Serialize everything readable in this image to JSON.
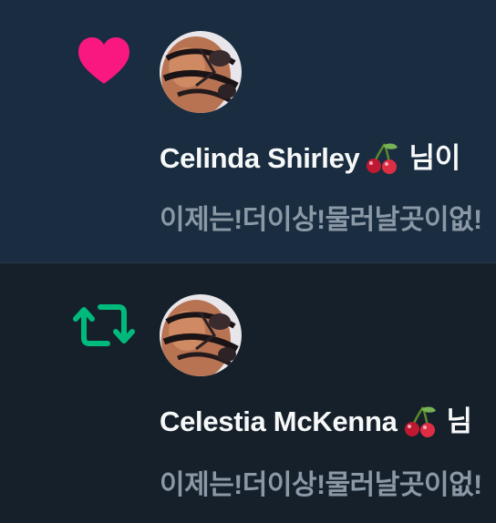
{
  "colors": {
    "unread_background": "#192c40",
    "read_background": "#15202b",
    "like": "#f91880",
    "retweet": "#00ba7c",
    "name_text": "#f7f9f9",
    "snippet_text": "#8b98a5"
  },
  "notifications": [
    {
      "type": "like",
      "icon": "heart-icon",
      "unread": true,
      "user_name": "Celinda Shirley",
      "name_emoji": "cherries-emoji",
      "action_suffix": "님이",
      "snippet": "이제는!더이상!물러날곳이없!"
    },
    {
      "type": "retweet",
      "icon": "retweet-icon",
      "unread": false,
      "user_name": "Celestia McKenna",
      "name_emoji": "cherries-emoji",
      "action_suffix": "님",
      "snippet": "이제는!더이상!물러날곳이없!"
    }
  ]
}
